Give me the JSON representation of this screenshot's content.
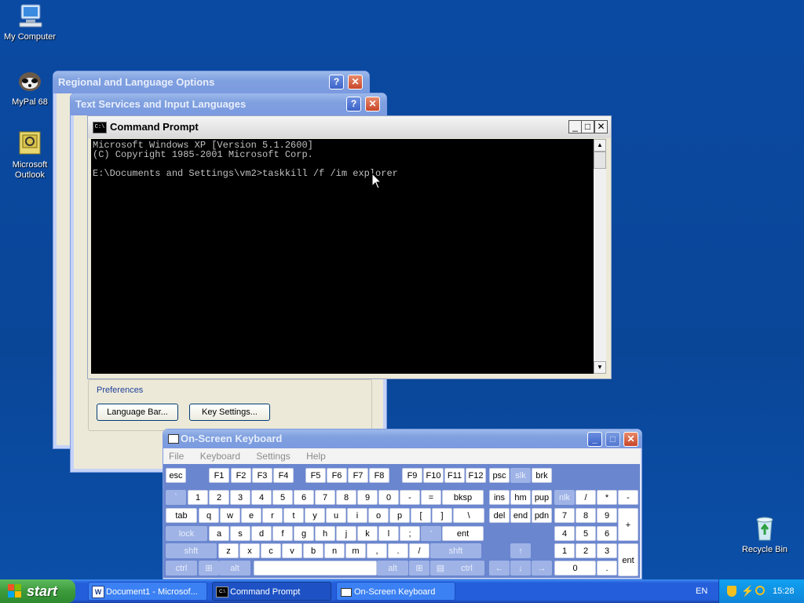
{
  "desktop": {
    "icons": [
      {
        "label": "My Computer"
      },
      {
        "label": "MyPal 68"
      },
      {
        "label": "Microsoft Outlook"
      },
      {
        "label": "Recycle Bin"
      }
    ]
  },
  "regional_window": {
    "title": "Regional and Language Options"
  },
  "text_services_window": {
    "title": "Text Services and Input Languages",
    "preferences_label": "Preferences",
    "language_bar_button": "Language Bar...",
    "key_settings_button": "Key Settings..."
  },
  "cmd_window": {
    "title": "Command Prompt",
    "lines": [
      "Microsoft Windows XP [Version 5.1.2600]",
      "(C) Copyright 1985-2001 Microsoft Corp.",
      "",
      "E:\\Documents and Settings\\vm2>taskkill /f /im explorer"
    ]
  },
  "osk_window": {
    "title": "On-Screen Keyboard",
    "menu": [
      "File",
      "Keyboard",
      "Settings",
      "Help"
    ],
    "rows": {
      "row0": [
        "esc",
        "F1",
        "F2",
        "F3",
        "F4",
        "F5",
        "F6",
        "F7",
        "F8",
        "F9",
        "F10",
        "F11",
        "F12",
        "psc",
        "slk",
        "brk"
      ],
      "row1": [
        "`",
        "1",
        "2",
        "3",
        "4",
        "5",
        "6",
        "7",
        "8",
        "9",
        "0",
        "-",
        "=",
        "bksp",
        "ins",
        "hm",
        "pup",
        "nlk",
        "/",
        "*",
        "-"
      ],
      "row2": [
        "tab",
        "q",
        "w",
        "e",
        "r",
        "t",
        "y",
        "u",
        "i",
        "o",
        "p",
        "[",
        "]",
        "\\",
        "del",
        "end",
        "pdn",
        "7",
        "8",
        "9",
        "+"
      ],
      "row3": [
        "lock",
        "a",
        "s",
        "d",
        "f",
        "g",
        "h",
        "j",
        "k",
        "l",
        ";",
        "'",
        "ent",
        "4",
        "5",
        "6"
      ],
      "row4": [
        "shft",
        "z",
        "x",
        "c",
        "v",
        "b",
        "n",
        "m",
        ",",
        ".",
        "/",
        "shft",
        "↑",
        "1",
        "2",
        "3",
        "ent"
      ],
      "row5": [
        "ctrl",
        "alt",
        "alt",
        "ctrl",
        "←",
        "↓",
        "→",
        "0",
        "."
      ]
    }
  },
  "taskbar": {
    "start_label": "start",
    "tasks": [
      "Document1 - Microsof...",
      "Command Prompt",
      "On-Screen Keyboard"
    ],
    "language": "EN",
    "clock": "15:28"
  },
  "colors": {
    "desktop": "#0a4a9e",
    "title_active": "#0a5bd9",
    "console_bg": "#000000"
  }
}
